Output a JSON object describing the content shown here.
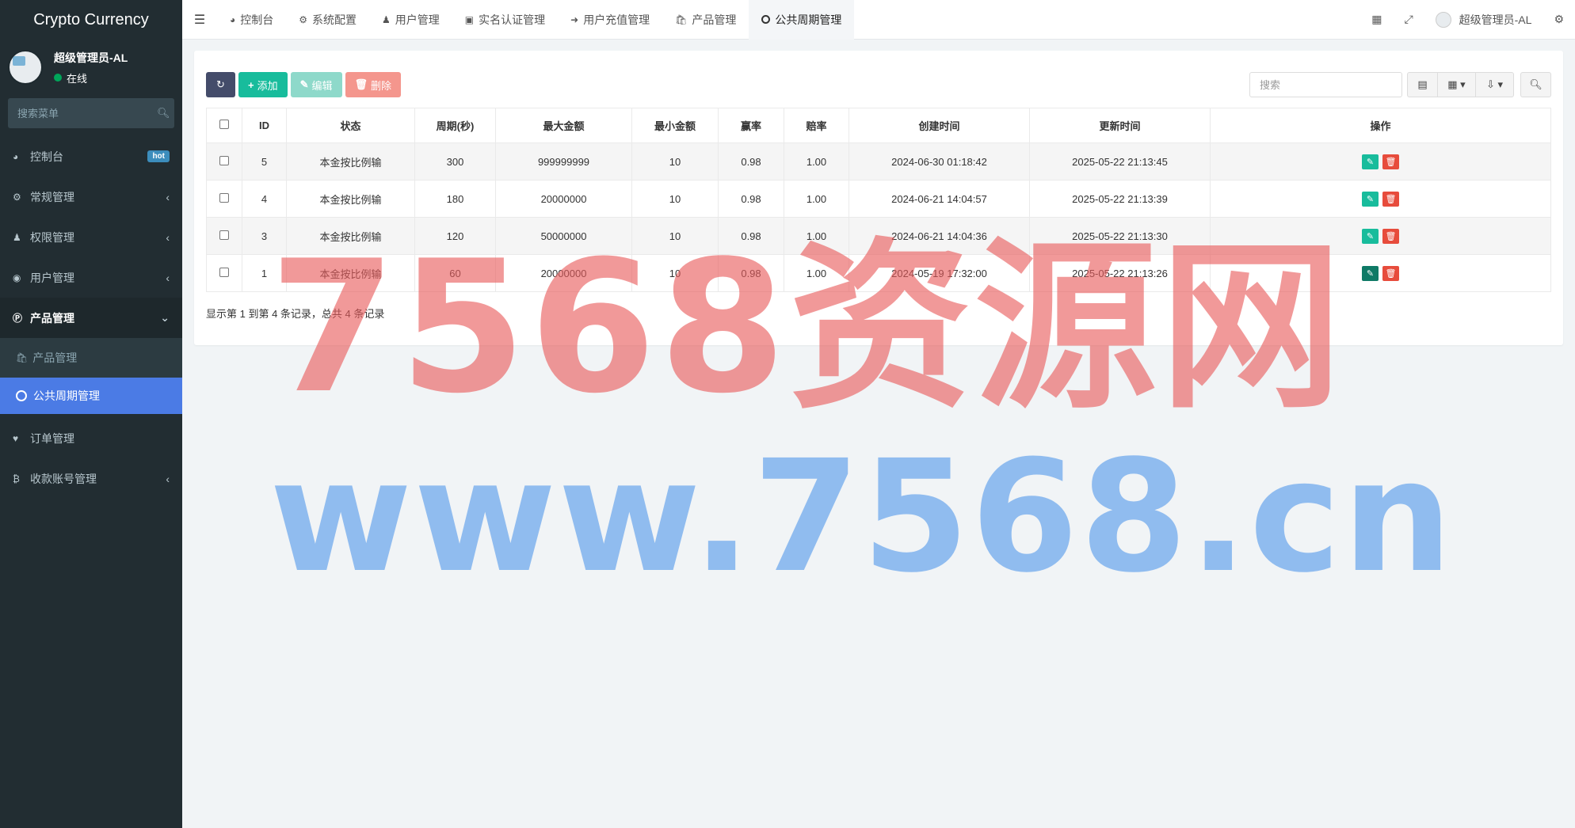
{
  "brand": "Crypto Currency",
  "user": {
    "name": "超级管理员-AL",
    "status": "在线"
  },
  "sidebar": {
    "search_placeholder": "搜索菜单",
    "items": [
      {
        "label": "控制台",
        "badge": "hot",
        "icon": "dashboard-icon"
      },
      {
        "label": "常规管理",
        "icon": "cogs-icon"
      },
      {
        "label": "权限管理",
        "icon": "group-icon"
      },
      {
        "label": "用户管理",
        "icon": "user-circle-icon"
      },
      {
        "label": "产品管理",
        "icon": "product-icon"
      },
      {
        "label": "产品管理",
        "icon": "shopping-bag-icon"
      },
      {
        "label": "公共周期管理",
        "icon": "circle-icon"
      },
      {
        "label": "订单管理",
        "icon": "heartbeat-icon"
      },
      {
        "label": "收款账号管理",
        "icon": "bitcoin-icon"
      }
    ]
  },
  "header": {
    "tabs": [
      {
        "label": "控制台",
        "icon": "dashboard-icon"
      },
      {
        "label": "系统配置",
        "icon": "cogs-icon"
      },
      {
        "label": "用户管理",
        "icon": "user-icon"
      },
      {
        "label": "实名认证管理",
        "icon": "id-card-icon"
      },
      {
        "label": "用户充值管理",
        "icon": "sign-in-icon"
      },
      {
        "label": "产品管理",
        "icon": "shopping-bag-icon"
      },
      {
        "label": "公共周期管理",
        "icon": "circle-icon"
      }
    ],
    "admin_name": "超级管理员-AL"
  },
  "toolbar": {
    "add_label": "添加",
    "edit_label": "编辑",
    "delete_label": "删除",
    "search_placeholder": "搜索"
  },
  "table": {
    "columns": [
      "ID",
      "状态",
      "周期(秒)",
      "最大金额",
      "最小金额",
      "赢率",
      "赔率",
      "创建时间",
      "更新时间",
      "操作"
    ],
    "rows": [
      {
        "id": "5",
        "status": "本金按比例输",
        "period": "300",
        "max": "999999999",
        "min": "10",
        "win": "0.98",
        "odds": "1.00",
        "created": "2024-06-30 01:18:42",
        "updated": "2025-05-22 21:13:45"
      },
      {
        "id": "4",
        "status": "本金按比例输",
        "period": "180",
        "max": "20000000",
        "min": "10",
        "win": "0.98",
        "odds": "1.00",
        "created": "2024-06-21 14:04:57",
        "updated": "2025-05-22 21:13:39"
      },
      {
        "id": "3",
        "status": "本金按比例输",
        "period": "120",
        "max": "50000000",
        "min": "10",
        "win": "0.98",
        "odds": "1.00",
        "created": "2024-06-21 14:04:36",
        "updated": "2025-05-22 21:13:30"
      },
      {
        "id": "1",
        "status": "本金按比例输",
        "period": "60",
        "max": "20000000",
        "min": "10",
        "win": "0.98",
        "odds": "1.00",
        "created": "2024-05-19 17:32:00",
        "updated": "2025-05-22 21:13:26"
      }
    ],
    "summary": "显示第 1 到第 4 条记录，总共 4 条记录"
  },
  "watermark": {
    "line1": "7568资源网",
    "line2": "www.7568.cn"
  }
}
